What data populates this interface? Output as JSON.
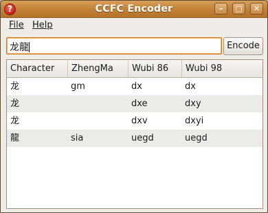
{
  "window": {
    "title": "CCFC Encoder"
  },
  "menu": {
    "file": "File",
    "help": "Help"
  },
  "input": {
    "value": "龙龍"
  },
  "encode_button": "Encode",
  "table": {
    "headers": [
      "Character",
      "ZhengMa",
      "Wubi 86",
      "Wubi 98"
    ],
    "rows": [
      [
        "龙",
        "gm",
        "dx",
        "dx"
      ],
      [
        "龙",
        "",
        "dxe",
        "dxy"
      ],
      [
        "龙",
        "",
        "dxv",
        "dxyi"
      ],
      [
        "龍",
        "sia",
        "uegd",
        "uegd"
      ]
    ]
  },
  "colors": {
    "titlebar": "#c48438",
    "focus_border": "#d9770f",
    "alt_row": "#edebe8"
  }
}
